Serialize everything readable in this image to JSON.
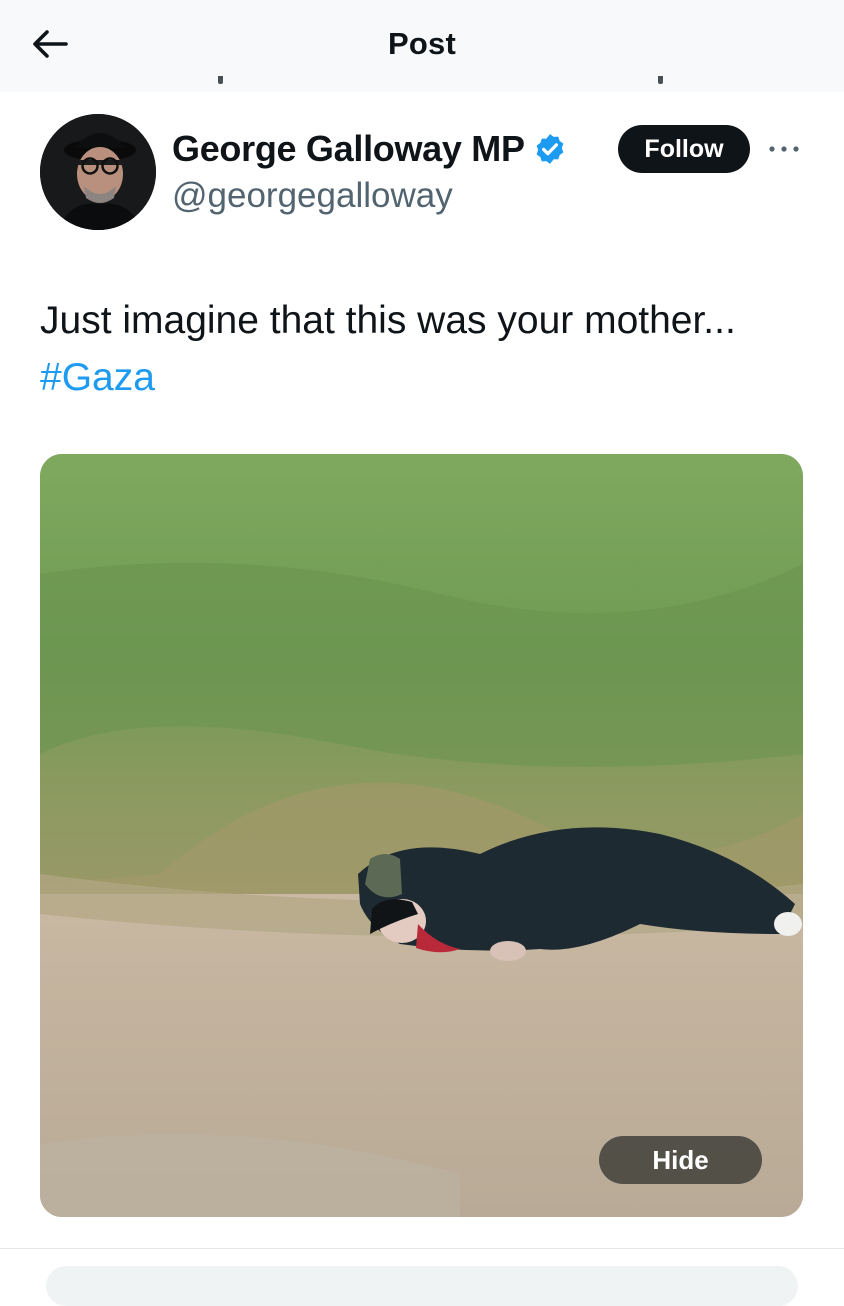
{
  "header": {
    "title": "Post",
    "back_icon": "arrow-left-icon"
  },
  "author": {
    "display_name": "George Galloway MP",
    "handle": "@georgegalloway",
    "verified_icon": "verified-badge-icon",
    "verified_color": "#1d9bf0",
    "follow_label": "Follow",
    "more_icon": "more-horizontal-icon"
  },
  "post": {
    "text": "Just imagine that this was your mother... ",
    "hashtag": "#Gaza",
    "hashtag_color": "#1d9bf0"
  },
  "media": {
    "hide_label": "Hide"
  },
  "colors": {
    "text_primary": "#0f1419",
    "text_secondary": "#536471",
    "button_dark": "#0f1419"
  }
}
